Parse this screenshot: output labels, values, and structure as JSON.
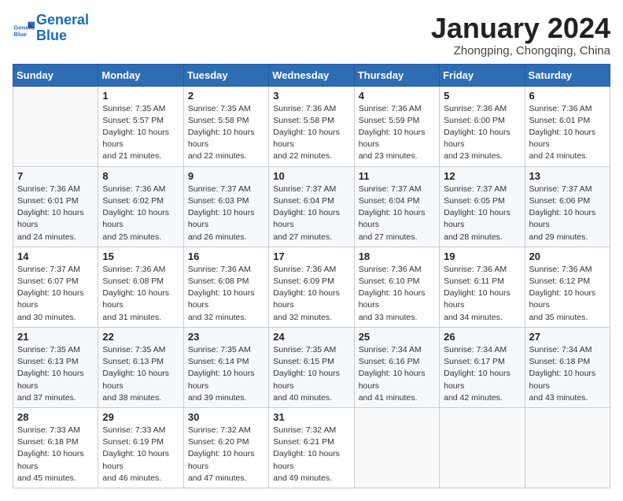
{
  "header": {
    "logo_line1": "General",
    "logo_line2": "Blue",
    "month_title": "January 2024",
    "subtitle": "Zhongping, Chongqing, China"
  },
  "weekdays": [
    "Sunday",
    "Monday",
    "Tuesday",
    "Wednesday",
    "Thursday",
    "Friday",
    "Saturday"
  ],
  "weeks": [
    [
      {
        "day": "",
        "sunrise": "",
        "sunset": "",
        "daylight": ""
      },
      {
        "day": "1",
        "sunrise": "Sunrise: 7:35 AM",
        "sunset": "Sunset: 5:57 PM",
        "daylight": "Daylight: 10 hours and 21 minutes."
      },
      {
        "day": "2",
        "sunrise": "Sunrise: 7:35 AM",
        "sunset": "Sunset: 5:58 PM",
        "daylight": "Daylight: 10 hours and 22 minutes."
      },
      {
        "day": "3",
        "sunrise": "Sunrise: 7:36 AM",
        "sunset": "Sunset: 5:58 PM",
        "daylight": "Daylight: 10 hours and 22 minutes."
      },
      {
        "day": "4",
        "sunrise": "Sunrise: 7:36 AM",
        "sunset": "Sunset: 5:59 PM",
        "daylight": "Daylight: 10 hours and 23 minutes."
      },
      {
        "day": "5",
        "sunrise": "Sunrise: 7:36 AM",
        "sunset": "Sunset: 6:00 PM",
        "daylight": "Daylight: 10 hours and 23 minutes."
      },
      {
        "day": "6",
        "sunrise": "Sunrise: 7:36 AM",
        "sunset": "Sunset: 6:01 PM",
        "daylight": "Daylight: 10 hours and 24 minutes."
      }
    ],
    [
      {
        "day": "7",
        "sunrise": "Sunrise: 7:36 AM",
        "sunset": "Sunset: 6:01 PM",
        "daylight": "Daylight: 10 hours and 24 minutes."
      },
      {
        "day": "8",
        "sunrise": "Sunrise: 7:36 AM",
        "sunset": "Sunset: 6:02 PM",
        "daylight": "Daylight: 10 hours and 25 minutes."
      },
      {
        "day": "9",
        "sunrise": "Sunrise: 7:37 AM",
        "sunset": "Sunset: 6:03 PM",
        "daylight": "Daylight: 10 hours and 26 minutes."
      },
      {
        "day": "10",
        "sunrise": "Sunrise: 7:37 AM",
        "sunset": "Sunset: 6:04 PM",
        "daylight": "Daylight: 10 hours and 27 minutes."
      },
      {
        "day": "11",
        "sunrise": "Sunrise: 7:37 AM",
        "sunset": "Sunset: 6:04 PM",
        "daylight": "Daylight: 10 hours and 27 minutes."
      },
      {
        "day": "12",
        "sunrise": "Sunrise: 7:37 AM",
        "sunset": "Sunset: 6:05 PM",
        "daylight": "Daylight: 10 hours and 28 minutes."
      },
      {
        "day": "13",
        "sunrise": "Sunrise: 7:37 AM",
        "sunset": "Sunset: 6:06 PM",
        "daylight": "Daylight: 10 hours and 29 minutes."
      }
    ],
    [
      {
        "day": "14",
        "sunrise": "Sunrise: 7:37 AM",
        "sunset": "Sunset: 6:07 PM",
        "daylight": "Daylight: 10 hours and 30 minutes."
      },
      {
        "day": "15",
        "sunrise": "Sunrise: 7:36 AM",
        "sunset": "Sunset: 6:08 PM",
        "daylight": "Daylight: 10 hours and 31 minutes."
      },
      {
        "day": "16",
        "sunrise": "Sunrise: 7:36 AM",
        "sunset": "Sunset: 6:08 PM",
        "daylight": "Daylight: 10 hours and 32 minutes."
      },
      {
        "day": "17",
        "sunrise": "Sunrise: 7:36 AM",
        "sunset": "Sunset: 6:09 PM",
        "daylight": "Daylight: 10 hours and 32 minutes."
      },
      {
        "day": "18",
        "sunrise": "Sunrise: 7:36 AM",
        "sunset": "Sunset: 6:10 PM",
        "daylight": "Daylight: 10 hours and 33 minutes."
      },
      {
        "day": "19",
        "sunrise": "Sunrise: 7:36 AM",
        "sunset": "Sunset: 6:11 PM",
        "daylight": "Daylight: 10 hours and 34 minutes."
      },
      {
        "day": "20",
        "sunrise": "Sunrise: 7:36 AM",
        "sunset": "Sunset: 6:12 PM",
        "daylight": "Daylight: 10 hours and 35 minutes."
      }
    ],
    [
      {
        "day": "21",
        "sunrise": "Sunrise: 7:35 AM",
        "sunset": "Sunset: 6:13 PM",
        "daylight": "Daylight: 10 hours and 37 minutes."
      },
      {
        "day": "22",
        "sunrise": "Sunrise: 7:35 AM",
        "sunset": "Sunset: 6:13 PM",
        "daylight": "Daylight: 10 hours and 38 minutes."
      },
      {
        "day": "23",
        "sunrise": "Sunrise: 7:35 AM",
        "sunset": "Sunset: 6:14 PM",
        "daylight": "Daylight: 10 hours and 39 minutes."
      },
      {
        "day": "24",
        "sunrise": "Sunrise: 7:35 AM",
        "sunset": "Sunset: 6:15 PM",
        "daylight": "Daylight: 10 hours and 40 minutes."
      },
      {
        "day": "25",
        "sunrise": "Sunrise: 7:34 AM",
        "sunset": "Sunset: 6:16 PM",
        "daylight": "Daylight: 10 hours and 41 minutes."
      },
      {
        "day": "26",
        "sunrise": "Sunrise: 7:34 AM",
        "sunset": "Sunset: 6:17 PM",
        "daylight": "Daylight: 10 hours and 42 minutes."
      },
      {
        "day": "27",
        "sunrise": "Sunrise: 7:34 AM",
        "sunset": "Sunset: 6:18 PM",
        "daylight": "Daylight: 10 hours and 43 minutes."
      }
    ],
    [
      {
        "day": "28",
        "sunrise": "Sunrise: 7:33 AM",
        "sunset": "Sunset: 6:18 PM",
        "daylight": "Daylight: 10 hours and 45 minutes."
      },
      {
        "day": "29",
        "sunrise": "Sunrise: 7:33 AM",
        "sunset": "Sunset: 6:19 PM",
        "daylight": "Daylight: 10 hours and 46 minutes."
      },
      {
        "day": "30",
        "sunrise": "Sunrise: 7:32 AM",
        "sunset": "Sunset: 6:20 PM",
        "daylight": "Daylight: 10 hours and 47 minutes."
      },
      {
        "day": "31",
        "sunrise": "Sunrise: 7:32 AM",
        "sunset": "Sunset: 6:21 PM",
        "daylight": "Daylight: 10 hours and 49 minutes."
      },
      {
        "day": "",
        "sunrise": "",
        "sunset": "",
        "daylight": ""
      },
      {
        "day": "",
        "sunrise": "",
        "sunset": "",
        "daylight": ""
      },
      {
        "day": "",
        "sunrise": "",
        "sunset": "",
        "daylight": ""
      }
    ]
  ]
}
